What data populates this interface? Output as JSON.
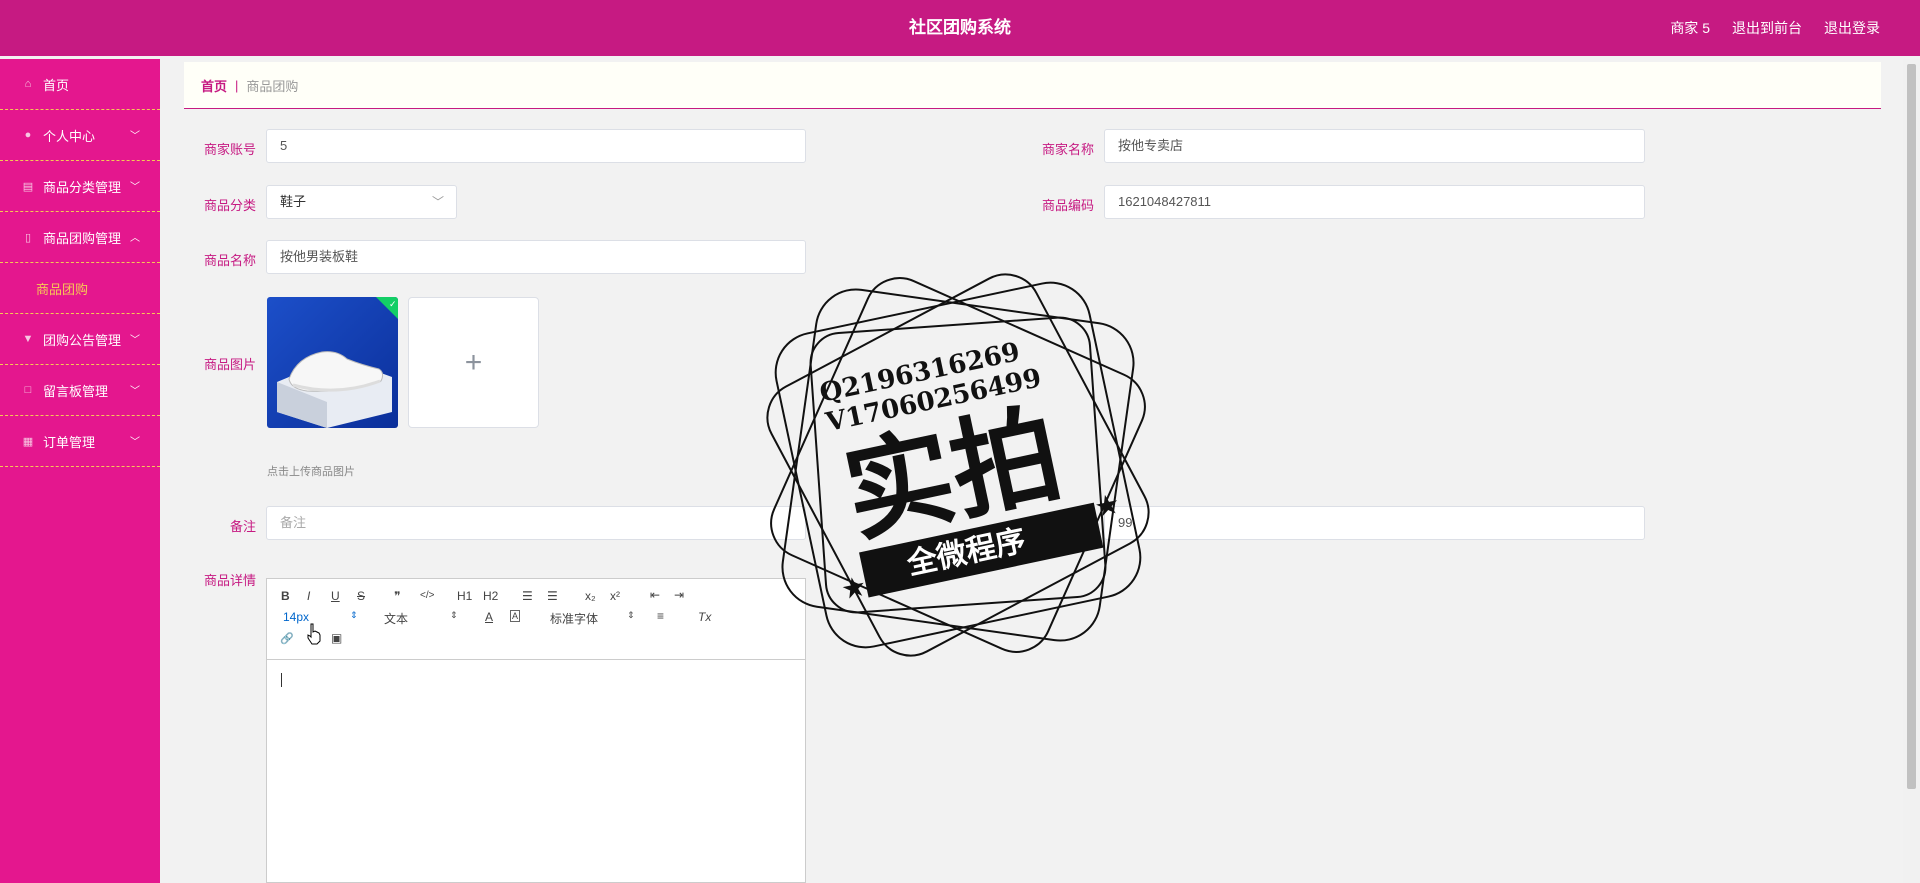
{
  "header": {
    "title": "社区团购系统",
    "user": "商家 5",
    "back_to_front": "退出到前台",
    "logout": "退出登录"
  },
  "sidebar": {
    "items": [
      {
        "label": "首页",
        "icon": "home-icon"
      },
      {
        "label": "个人中心",
        "icon": "user-icon"
      },
      {
        "label": "商品分类管理",
        "icon": "clipboard-icon"
      },
      {
        "label": "商品团购管理",
        "icon": "mic-icon"
      },
      {
        "label": "团购公告管理",
        "icon": "pin-icon"
      },
      {
        "label": "留言板管理",
        "icon": "square-icon"
      },
      {
        "label": "订单管理",
        "icon": "grid-icon"
      }
    ],
    "submenu": {
      "label": "商品团购"
    }
  },
  "breadcrumb": {
    "home": "首页",
    "separator": "|",
    "current": "商品团购"
  },
  "form": {
    "merchant_account": {
      "label": "商家账号",
      "value": "5"
    },
    "merchant_name": {
      "label": "商家名称",
      "value": "按他专卖店"
    },
    "category": {
      "label": "商品分类",
      "value": "鞋子"
    },
    "product_code": {
      "label": "商品编码",
      "value": "1621048427811"
    },
    "product_name": {
      "label": "商品名称",
      "value": "按他男装板鞋"
    },
    "product_image": {
      "label": "商品图片",
      "hint": "点击上传商品图片",
      "add_symbol": "+"
    },
    "remark": {
      "label": "备注",
      "placeholder": "备注"
    },
    "price": {
      "value": "99"
    },
    "details": {
      "label": "商品详情"
    }
  },
  "editor": {
    "toolbar": {
      "bold": "B",
      "italic": "I",
      "underline": "U",
      "strike": "S",
      "quote": "❞",
      "code": "</>",
      "h1": "H1",
      "h2": "H2",
      "ordered_list": "☰",
      "bullet_list": "☰",
      "subscript": "x₂",
      "superscript": "x²",
      "indent_left": "⇤",
      "indent_right": "⇥",
      "size": "14px",
      "header": "文本",
      "color": "A",
      "background": "A",
      "font": "标准字体",
      "align": "≡",
      "clean": "Tx",
      "link": "🔗",
      "video": "▣"
    }
  },
  "watermark": {
    "line1": "Q2196316269",
    "line2": "V17060256499",
    "big": "实拍",
    "banner": "全微程序"
  },
  "colors": {
    "primary": "#c61a82",
    "sidebar": "#e4178e",
    "accent": "#f6c955"
  }
}
